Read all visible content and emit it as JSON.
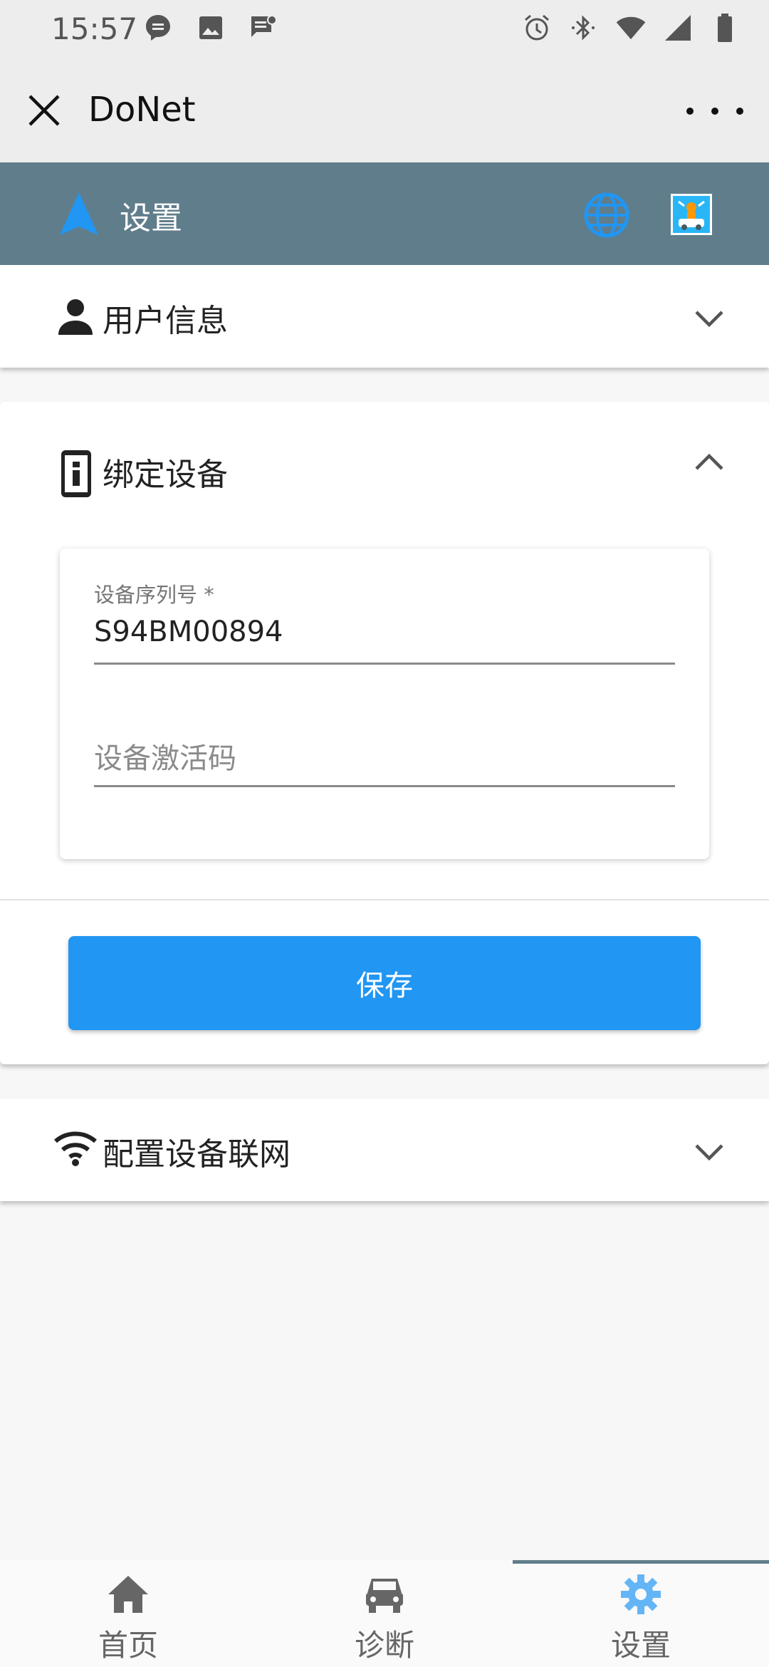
{
  "status_bar": {
    "time": "15:57",
    "left_icons": [
      "message-bubble-icon",
      "image-icon",
      "chat-icon"
    ],
    "right_icons": [
      "alarm-icon",
      "bluetooth-icon",
      "wifi-icon",
      "signal-icon",
      "battery-icon"
    ]
  },
  "app_bar": {
    "title": "DoNet",
    "close_icon": "close-icon",
    "more_icon": "more-icon"
  },
  "header": {
    "title": "设置",
    "nav_icon": "navigation-arrow-icon",
    "globe_icon": "globe-icon",
    "accent_color": "#607d8b"
  },
  "panels": {
    "user_info": {
      "title": "用户信息",
      "icon": "person-icon",
      "expanded": false
    },
    "bind_device": {
      "title": "绑定设备",
      "icon": "device-info-icon",
      "expanded": true,
      "serial_field": {
        "label": "设备序列号 *",
        "value": "S94BM00894"
      },
      "activation_field": {
        "placeholder": "设备激活码",
        "value": ""
      },
      "save_label": "保存"
    },
    "network": {
      "title": "配置设备联网",
      "icon": "wifi-icon",
      "expanded": false
    }
  },
  "bottom_nav": {
    "items": [
      {
        "label": "首页",
        "icon": "home-icon",
        "active": false
      },
      {
        "label": "诊断",
        "icon": "car-icon",
        "active": false
      },
      {
        "label": "设置",
        "icon": "gear-icon",
        "active": true
      }
    ],
    "active_color": "#64b5f6"
  }
}
